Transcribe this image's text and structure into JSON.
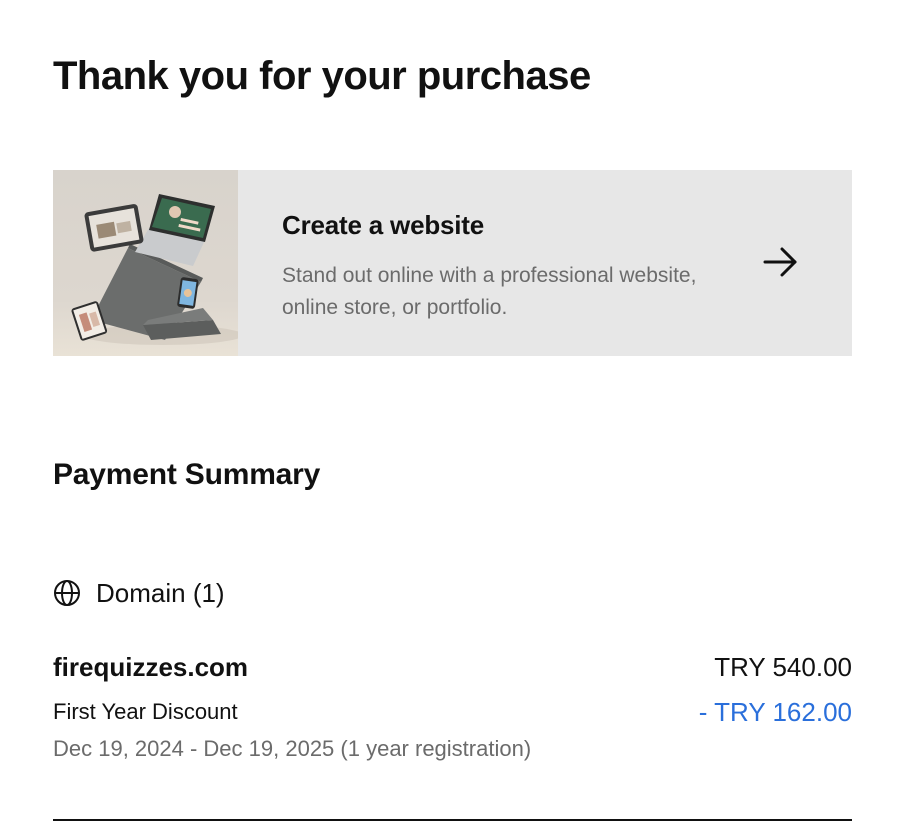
{
  "page": {
    "title": "Thank you for your purchase"
  },
  "promo": {
    "title": "Create a website",
    "description": "Stand out online with a professional website, online store, or portfolio.",
    "arrow_icon": "arrow-right-icon"
  },
  "summary": {
    "title": "Payment Summary",
    "category_icon": "globe-icon",
    "category_label": "Domain (1)",
    "item": {
      "name": "firequizzes.com",
      "price": "TRY 540.00",
      "discount_label": "First Year Discount",
      "discount_amount": "- TRY 162.00",
      "term": "Dec 19, 2024 - Dec 19, 2025 (1 year registration)"
    }
  },
  "colors": {
    "promo_background": "#e7e7e7",
    "discount": "#2a6fdb",
    "muted_text": "#6b6b6b"
  }
}
